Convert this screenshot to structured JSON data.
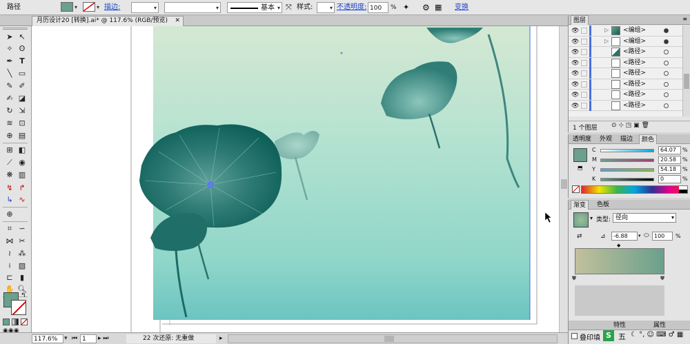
{
  "control_bar": {
    "selection_type": "路径",
    "stroke_label": "描边:",
    "brush_label": "基本",
    "style_label": "样式:",
    "opacity_label": "不透明度:",
    "opacity_value": "100",
    "opacity_unit": "%",
    "transform_label": "变换",
    "fill_color": "#6aa08c"
  },
  "document": {
    "tab_title": "月历设计20 [转换].ai* @ 117.6% (RGB/预览)"
  },
  "status": {
    "zoom": "117.6%",
    "artboard": "1",
    "undo_text": "22 次还原: 无重做"
  },
  "layers_panel": {
    "tab": "图层",
    "layers": [
      {
        "name": "<编组>",
        "expandable": true,
        "targeted": true
      },
      {
        "name": "<编组>",
        "expandable": true,
        "targeted": true
      },
      {
        "name": "<路径>",
        "expandable": false,
        "targeted": false
      },
      {
        "name": "<路径>",
        "expandable": false,
        "targeted": false
      },
      {
        "name": "<路径>",
        "expandable": false,
        "targeted": false
      },
      {
        "name": "<路径>",
        "expandable": false,
        "targeted": false
      },
      {
        "name": "<路径>",
        "expandable": false,
        "targeted": false
      },
      {
        "name": "<路径>",
        "expandable": false,
        "targeted": false
      }
    ],
    "footer": "1 个图层"
  },
  "color_panel": {
    "tabs": [
      "透明度",
      "外观",
      "描边",
      "颜色"
    ],
    "active_tab": "颜色",
    "channels": [
      {
        "label": "C",
        "value": "64.07",
        "unit": "%"
      },
      {
        "label": "M",
        "value": "20.58",
        "unit": "%"
      },
      {
        "label": "Y",
        "value": "54.18",
        "unit": "%"
      },
      {
        "label": "K",
        "value": "0",
        "unit": "%"
      }
    ]
  },
  "gradient_panel": {
    "tabs": [
      "渐变",
      "色板"
    ],
    "active_tab": "渐变",
    "type_label": "类型:",
    "type_value": "径向",
    "angle_value": "-6.88",
    "ratio_value": "100",
    "ratio_unit": "%"
  },
  "bottom_panel": {
    "tabs": [
      "特性",
      "属性"
    ],
    "overprint_label": "叠印填"
  },
  "taskbar": {
    "ime_label": "五"
  }
}
